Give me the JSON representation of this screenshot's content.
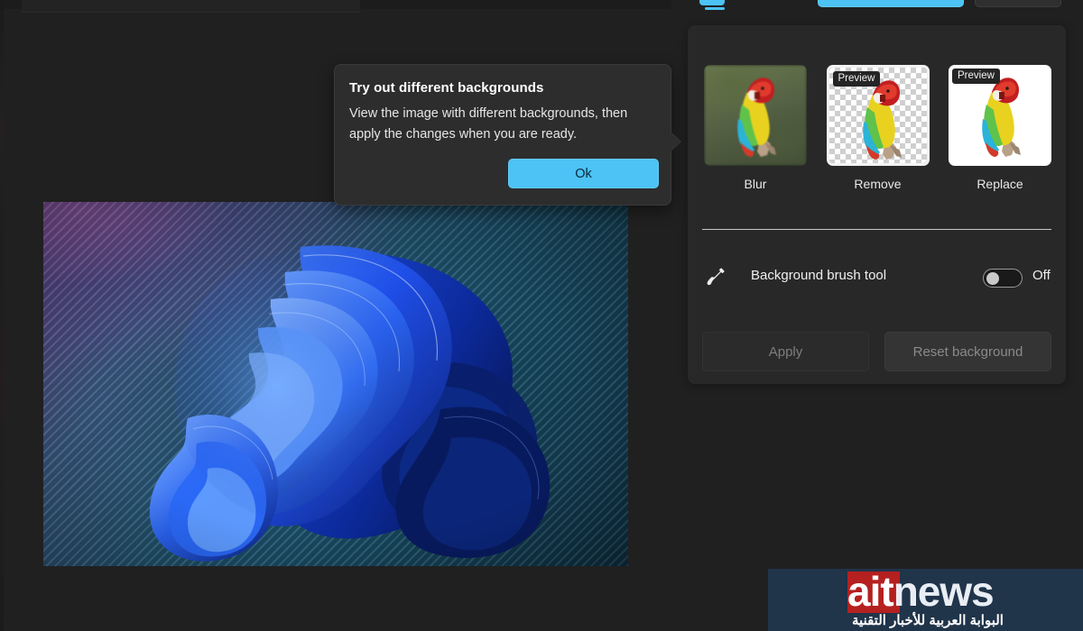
{
  "app": {
    "theme_bg": "#202020",
    "panel_bg": "#282828",
    "accent": "#4cc2f5"
  },
  "callout": {
    "title": "Try out different backgrounds",
    "body": "View the image with different backgrounds, then apply the changes when you are ready.",
    "ok_label": "Ok",
    "accent": "#4cc2f5"
  },
  "background_panel": {
    "options": [
      {
        "label": "Blur",
        "badge": "",
        "selected": false,
        "style": "blurred-photo"
      },
      {
        "label": "Remove",
        "badge": "Preview",
        "selected": true,
        "style": "transparent-checker"
      },
      {
        "label": "Replace",
        "badge": "Preview",
        "selected": false,
        "style": "white-fill"
      }
    ],
    "brush_tool": {
      "icon": "brush-icon",
      "label": "Background brush tool",
      "toggle_state": "Off",
      "toggle_on": false
    },
    "actions": {
      "apply_label": "Apply",
      "apply_enabled": false,
      "reset_label": "Reset background",
      "reset_enabled": false
    }
  },
  "canvas": {
    "image_description": "Windows 11 Bloom wallpaper on striped gradient background"
  },
  "watermark": {
    "brand_part1": "ait",
    "brand_part2": "news",
    "tagline_arabic": "البوابة العربية للأخبار التقنية",
    "bg_color": "#20344a",
    "accent_color": "#b52020"
  }
}
